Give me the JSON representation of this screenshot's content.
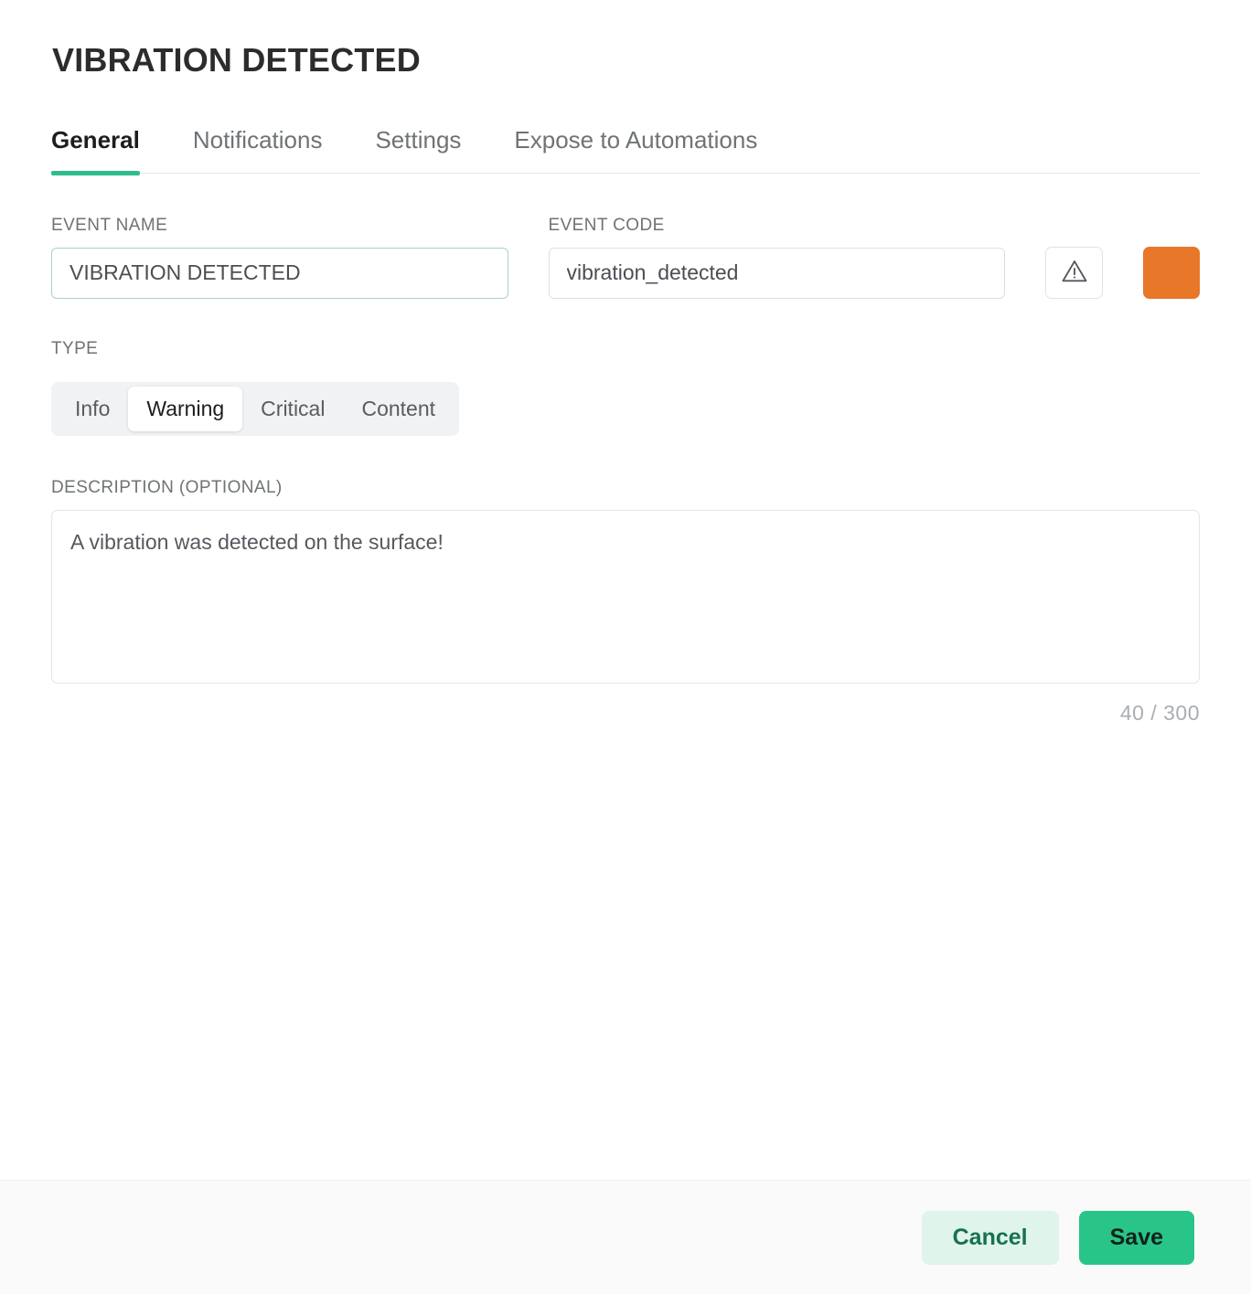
{
  "dialog": {
    "title": "VIBRATION DETECTED"
  },
  "tabs": [
    {
      "label": "General",
      "active": true
    },
    {
      "label": "Notifications",
      "active": false
    },
    {
      "label": "Settings",
      "active": false
    },
    {
      "label": "Expose to Automations",
      "active": false
    }
  ],
  "fields": {
    "event_name": {
      "label": "EVENT NAME",
      "value": "VIBRATION DETECTED",
      "placeholder": "Event name",
      "focused": true
    },
    "event_code": {
      "label": "EVENT CODE",
      "value": "vibration_detected",
      "placeholder": "Event code",
      "focused": false
    },
    "icon_button": {
      "icon": "warning-triangle-icon"
    },
    "color_swatch": {
      "color": "#e8772a"
    }
  },
  "type": {
    "label": "TYPE",
    "options": [
      "Info",
      "Warning",
      "Critical",
      "Content"
    ],
    "selected": "Warning"
  },
  "description": {
    "label": "DESCRIPTION (OPTIONAL)",
    "value": "A vibration was detected on the surface!",
    "placeholder": "Description",
    "counter": "40 / 300",
    "char_count": 40,
    "char_limit": 300
  },
  "footer": {
    "cancel_label": "Cancel",
    "save_label": "Save"
  },
  "colors": {
    "accent_green": "#2fbd8c",
    "save_green": "#29c488",
    "cancel_mint": "#dff4ea",
    "cancel_text": "#17714f",
    "swatch_orange": "#e8772a",
    "focus_border": "#a7d4c3"
  }
}
